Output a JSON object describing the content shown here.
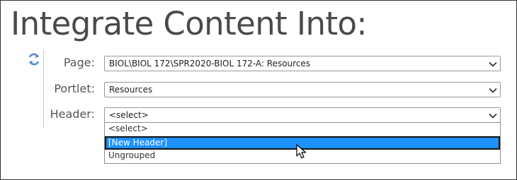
{
  "title": "Integrate Content Into:",
  "icons": {
    "refresh": "refresh-icon",
    "chevron": "chevron-down-icon",
    "cursor": "mouse-pointer-icon"
  },
  "colors": {
    "refresh_icon": "#5b8fc9",
    "selected_option_bg": "#1e90ff",
    "title_text": "#4a4a4a"
  },
  "fields": {
    "page": {
      "label": "Page:",
      "value": "BIOL\\BIOL 172\\SPR2020-BIOL 172-A: Resources"
    },
    "portlet": {
      "label": "Portlet:",
      "value": "Resources"
    },
    "header": {
      "label": "Header:",
      "value": "<select>",
      "options": [
        "<select>",
        "[New Header]",
        "Ungrouped"
      ],
      "highlighted_option": "[New Header]"
    }
  }
}
